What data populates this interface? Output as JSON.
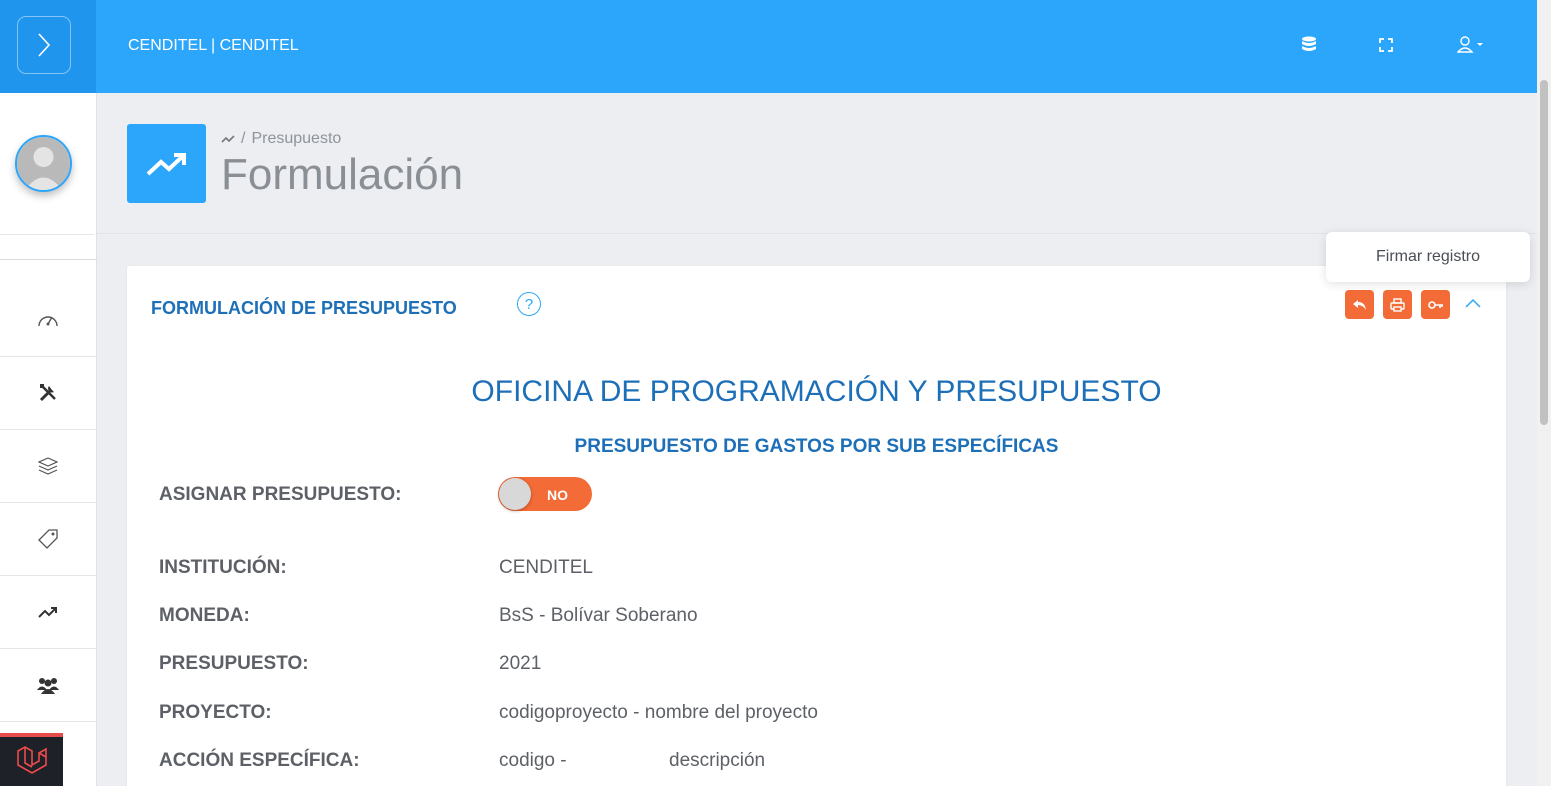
{
  "topbar": {
    "brand": "CENDITEL | CENDITEL",
    "icons": [
      "menu-toggle-icon",
      "database-icon",
      "fullscreen-icon",
      "user-icon"
    ]
  },
  "sidebar": {
    "items": [
      "dashboard-icon",
      "tools-icon",
      "layers-icon",
      "tag-icon",
      "trending-icon",
      "users-icon"
    ]
  },
  "header": {
    "breadcrumb": "Presupuesto",
    "title": "Formulación"
  },
  "card": {
    "title": "FORMULACIÓN DE PRESUPUESTO",
    "help": "?",
    "tooltip": "Firmar registro",
    "office_title": "OFICINA DE PROGRAMACIÓN Y PRESUPUESTO",
    "office_subtitle": "PRESUPUESTO DE GASTOS POR SUB ESPECÍFICAS",
    "assign_label": "ASIGNAR PRESUPUESTO:",
    "assign_toggle": "NO",
    "fields": [
      {
        "label": "INSTITUCIÓN:",
        "value": "CENDITEL"
      },
      {
        "label": "MONEDA:",
        "value": "BsS - Bolívar Soberano"
      },
      {
        "label": "PRESUPUESTO:",
        "value": "2021"
      },
      {
        "label": "PROYECTO:",
        "value": "codigoproyecto - nombre del proyecto"
      },
      {
        "label": "ACCIÓN ESPECÍFICA:",
        "value": "codigo -",
        "value2": "descripción"
      }
    ]
  },
  "colors": {
    "primary": "#2ba6fb",
    "accent": "#f36b36",
    "heading": "#1d6fb8"
  }
}
